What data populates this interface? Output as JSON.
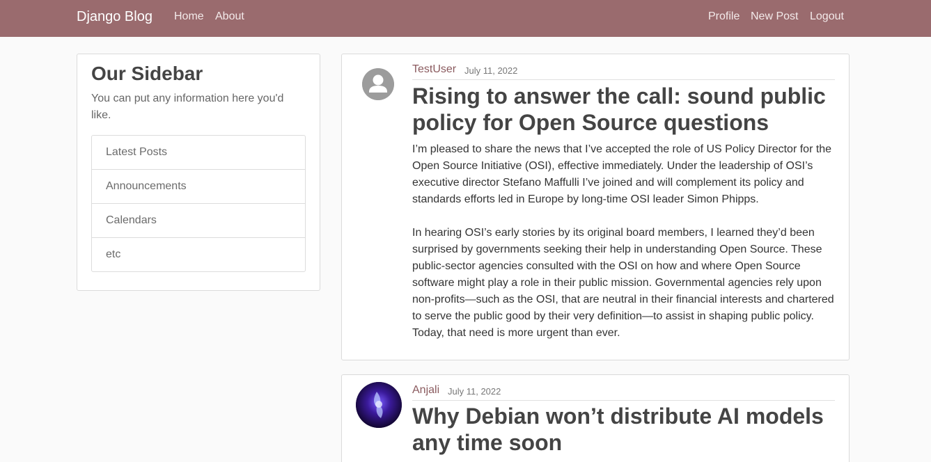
{
  "nav": {
    "brand": "Django Blog",
    "left_links": [
      "Home",
      "About"
    ],
    "right_links": [
      "Profile",
      "New Post",
      "Logout"
    ]
  },
  "sidebar": {
    "title": "Our Sidebar",
    "text": "You can put any information here you'd like.",
    "items": [
      "Latest Posts",
      "Announcements",
      "Calendars",
      "etc"
    ]
  },
  "posts": [
    {
      "author": "TestUser",
      "date": "July 11, 2022",
      "avatar": "default-user-icon",
      "title": "Rising to answer the call: sound public policy for Open Source questions",
      "paragraphs": [
        "I’m pleased to share the news that I’ve accepted the role of US Policy Director for the Open Source Initiative (OSI), effective immediately. Under the leadership of OSI’s executive director Stefano Maffulli I’ve joined and will complement its policy and standards efforts led in Europe by long-time OSI leader Simon Phipps.",
        "In hearing OSI’s early stories by its original board members, I learned they’d been surprised by governments seeking their help in understanding Open Source. These public-sector agencies consulted with the OSI on how and where Open Source software might play a role in their public mission. Governmental agencies rely upon non-profits—such as the OSI, that are neutral in their financial interests and chartered to serve the public good by their very definition—to assist in shaping public policy. Today, that need is more urgent than ever."
      ]
    },
    {
      "author": "Anjali",
      "date": "July 11, 2022",
      "avatar": "profile-photo",
      "title": "Why Debian won’t distribute AI models any time soon"
    }
  ]
}
